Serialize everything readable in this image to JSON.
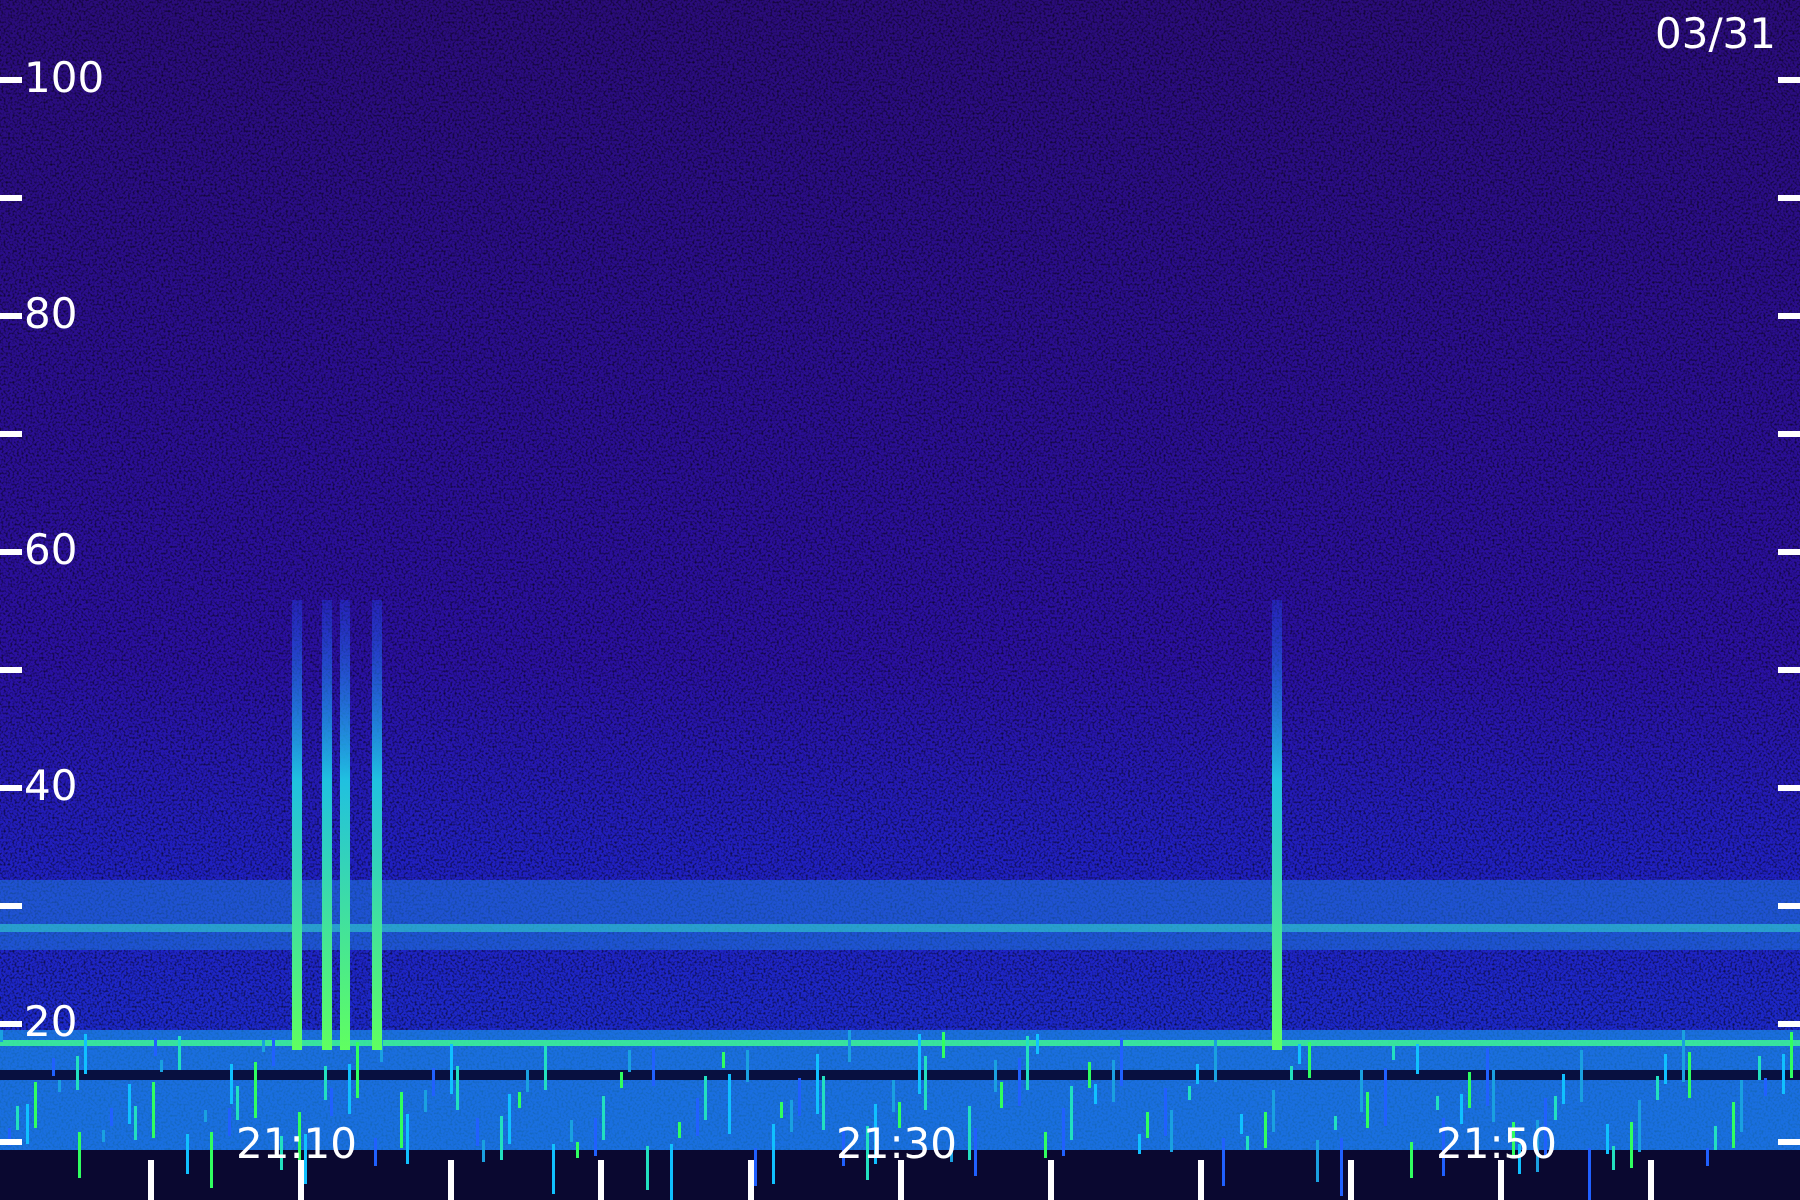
{
  "date": "03/31",
  "y_axis": {
    "labels": [
      "100",
      "80",
      "60",
      "40",
      "20"
    ]
  },
  "x_axis": {
    "labels": [
      "21:10",
      "21:30",
      "21:50"
    ]
  }
}
